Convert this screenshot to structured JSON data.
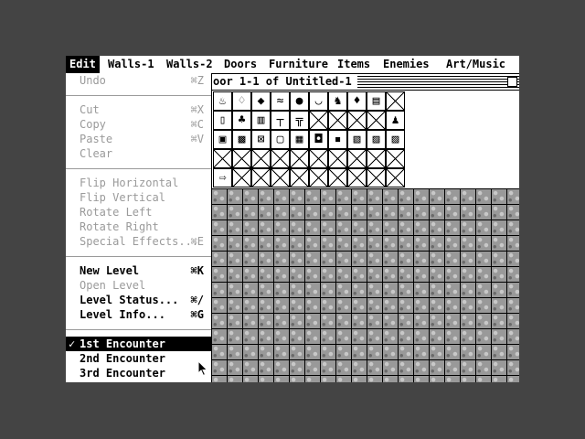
{
  "menubar": [
    "Edit",
    "Walls-1",
    "Walls-2",
    "Doors",
    "Furniture",
    "Items",
    "Enemies",
    "Art/Music"
  ],
  "window": {
    "title": "oor 1-1 of Untitled-1"
  },
  "edit_menu": {
    "undo": {
      "label": "Undo",
      "shortcut": "⌘Z"
    },
    "cut": {
      "label": "Cut",
      "shortcut": "⌘X"
    },
    "copy": {
      "label": "Copy",
      "shortcut": "⌘C"
    },
    "paste": {
      "label": "Paste",
      "shortcut": "⌘V"
    },
    "clear": {
      "label": "Clear"
    },
    "flip_horizontal": {
      "label": "Flip Horizontal"
    },
    "flip_vertical": {
      "label": "Flip Vertical"
    },
    "rotate_left": {
      "label": "Rotate Left"
    },
    "rotate_right": {
      "label": "Rotate Right"
    },
    "special_effects": {
      "label": "Special Effects...",
      "shortcut": "⌘E"
    },
    "new_level": {
      "label": "New Level",
      "shortcut": "⌘K"
    },
    "open_level": {
      "label": "Open Level"
    },
    "level_status": {
      "label": "Level Status...",
      "shortcut": "⌘/"
    },
    "level_info": {
      "label": "Level Info...",
      "shortcut": "⌘G"
    },
    "encounter_1": {
      "label": "1st Encounter",
      "check": "✓"
    },
    "encounter_2": {
      "label": "2nd Encounter"
    },
    "encounter_3": {
      "label": "3rd Encounter"
    }
  },
  "palette_icons": [
    [
      "lamp-icon",
      "bottle-icon",
      "vase-icon",
      "bones-icon",
      "green-helmet-icon",
      "bowl-icon",
      "knight-icon",
      "lantern-icon",
      "chest-icon",
      "empty"
    ],
    [
      "cup-icon",
      "bush-icon",
      "barrel-icon",
      "table-icon",
      "chair-icon",
      "empty",
      "empty",
      "empty",
      "empty",
      "guard-icon"
    ],
    [
      "gray-cabinet-icon",
      "gray-door-icon",
      "red-sign-icon",
      "portrait-icon",
      "wood-door-icon",
      "painting-icon",
      "portrait-dark-icon",
      "blue-panel-icon",
      "blue-door-icon",
      "blue-door-2-icon"
    ],
    [
      "empty",
      "empty",
      "empty",
      "empty",
      "empty",
      "empty",
      "empty",
      "empty",
      "empty",
      "empty"
    ],
    [
      "arrow-icon",
      "empty",
      "empty",
      "empty",
      "empty",
      "empty",
      "empty",
      "empty",
      "empty",
      "empty"
    ]
  ],
  "palette_glyphs": {
    "lamp-icon": "♨",
    "bottle-icon": "♢",
    "vase-icon": "◆",
    "bones-icon": "≈",
    "green-helmet-icon": "●",
    "bowl-icon": "◡",
    "knight-icon": "♞",
    "lantern-icon": "♦",
    "chest-icon": "▤",
    "cup-icon": "▯",
    "bush-icon": "♣",
    "barrel-icon": "▥",
    "table-icon": "┬",
    "chair-icon": "╦",
    "guard-icon": "♟",
    "gray-cabinet-icon": "▣",
    "gray-door-icon": "▩",
    "red-sign-icon": "⊠",
    "portrait-icon": "▢",
    "wood-door-icon": "▦",
    "painting-icon": "◘",
    "portrait-dark-icon": "▪",
    "blue-panel-icon": "▧",
    "blue-door-icon": "▨",
    "blue-door-2-icon": "▨",
    "arrow-icon": "⇨"
  },
  "colors": {
    "accent": "#000000",
    "disabled": "#9a9a9a",
    "floor": "#999999",
    "desktop": "#444444"
  }
}
